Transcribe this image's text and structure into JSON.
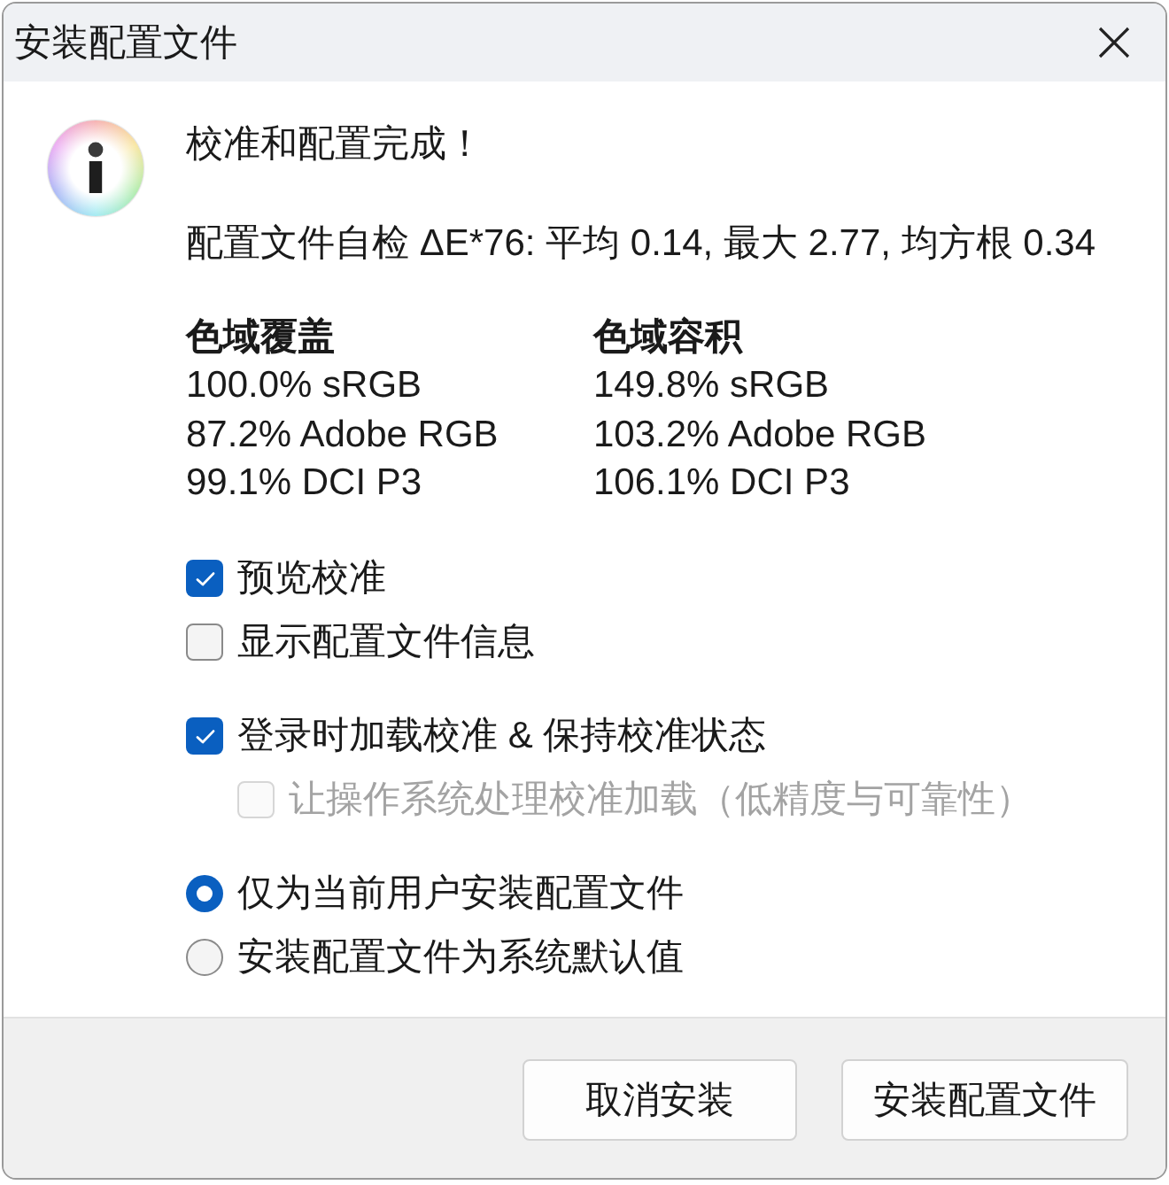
{
  "window": {
    "title": "安装配置文件"
  },
  "message": {
    "heading": "校准和配置完成！",
    "self_check": "配置文件自检 ΔE*76: 平均 0.14, 最大 2.77, 均方根 0.34"
  },
  "gamut": [
    {
      "heading": "色域覆盖",
      "lines": [
        "100.0% sRGB",
        "87.2% Adobe RGB",
        "99.1% DCI P3"
      ]
    },
    {
      "heading": "色域容积",
      "lines": [
        "149.8% sRGB",
        "103.2% Adobe RGB",
        "106.1% DCI P3"
      ]
    }
  ],
  "option_groups": [
    {
      "items": [
        {
          "kind": "checkbox",
          "label": "预览校准",
          "checked": true,
          "disabled": false
        },
        {
          "kind": "checkbox",
          "label": "显示配置文件信息",
          "checked": false,
          "disabled": false
        }
      ]
    },
    {
      "items": [
        {
          "kind": "checkbox",
          "label": "登录时加载校准 & 保持校准状态",
          "checked": true,
          "disabled": false,
          "children": [
            {
              "kind": "checkbox",
              "label": "让操作系统处理校准加载（低精度与可靠性）",
              "checked": false,
              "disabled": true
            }
          ]
        }
      ]
    },
    {
      "items": [
        {
          "kind": "radio",
          "label": "仅为当前用户安装配置文件",
          "selected": true,
          "disabled": false
        },
        {
          "kind": "radio",
          "label": "安装配置文件为系统默认值",
          "selected": false,
          "disabled": false
        }
      ]
    }
  ],
  "buttons": [
    {
      "label": "取消安装"
    },
    {
      "label": "安装配置文件"
    }
  ]
}
